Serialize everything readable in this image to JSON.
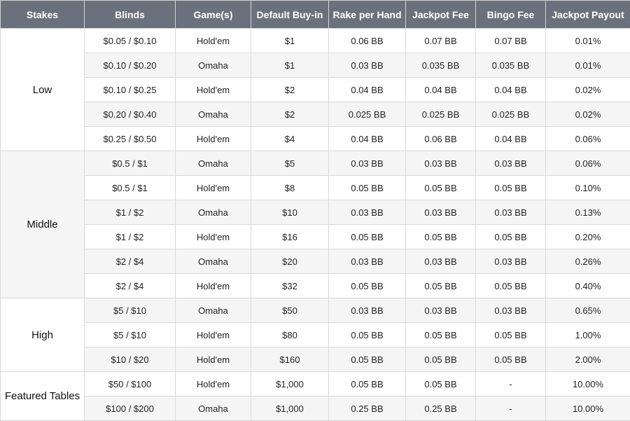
{
  "headers": [
    "Stakes",
    "Blinds",
    "Game(s)",
    "Default Buy-in",
    "Rake per Hand",
    "Jackpot Fee",
    "Bingo Fee",
    "Jackpot Payout"
  ],
  "groups": [
    {
      "stakes": "Low",
      "rows": [
        [
          "$0.05 / $0.10",
          "Hold'em",
          "$1",
          "0.06 BB",
          "0.07 BB",
          "0.07 BB",
          "0.01%"
        ],
        [
          "$0.10 / $0.20",
          "Omaha",
          "$1",
          "0.03 BB",
          "0.035 BB",
          "0.035 BB",
          "0.01%"
        ],
        [
          "$0.10 / $0.25",
          "Hold'em",
          "$2",
          "0.04 BB",
          "0.04 BB",
          "0.04 BB",
          "0.02%"
        ],
        [
          "$0.20 / $0.40",
          "Omaha",
          "$2",
          "0.025 BB",
          "0.025 BB",
          "0.025 BB",
          "0.02%"
        ],
        [
          "$0.25 / $0.50",
          "Hold'em",
          "$4",
          "0.04 BB",
          "0.06 BB",
          "0.04 BB",
          "0.06%"
        ]
      ]
    },
    {
      "stakes": "Middle",
      "rows": [
        [
          "$0.5 / $1",
          "Omaha",
          "$5",
          "0.03 BB",
          "0.03 BB",
          "0.03 BB",
          "0.06%"
        ],
        [
          "$0.5 / $1",
          "Hold'em",
          "$8",
          "0.05 BB",
          "0.05 BB",
          "0.05 BB",
          "0.10%"
        ],
        [
          "$1 / $2",
          "Omaha",
          "$10",
          "0.03 BB",
          "0.03 BB",
          "0.03 BB",
          "0.13%"
        ],
        [
          "$1 / $2",
          "Hold'em",
          "$16",
          "0.05 BB",
          "0.05 BB",
          "0.05 BB",
          "0.20%"
        ],
        [
          "$2 / $4",
          "Omaha",
          "$20",
          "0.03 BB",
          "0.03 BB",
          "0.03 BB",
          "0.26%"
        ],
        [
          "$2 / $4",
          "Hold'em",
          "$32",
          "0.05 BB",
          "0.05 BB",
          "0.05 BB",
          "0.40%"
        ]
      ]
    },
    {
      "stakes": "High",
      "rows": [
        [
          "$5 / $10",
          "Omaha",
          "$50",
          "0.03 BB",
          "0.03 BB",
          "0.03 BB",
          "0.65%"
        ],
        [
          "$5 / $10",
          "Hold'em",
          "$80",
          "0.05 BB",
          "0.05 BB",
          "0.05 BB",
          "1.00%"
        ],
        [
          "$10 / $20",
          "Hold'em",
          "$160",
          "0.05 BB",
          "0.05 BB",
          "0.05 BB",
          "2.00%"
        ]
      ]
    },
    {
      "stakes": "Featured Tables",
      "rows": [
        [
          "$50 / $100",
          "Hold'em",
          "$1,000",
          "0.05 BB",
          "0.05 BB",
          "-",
          "10.00%"
        ],
        [
          "$100 / $200",
          "Omaha",
          "$1,000",
          "0.25 BB",
          "0.25 BB",
          "-",
          "10.00%"
        ]
      ]
    }
  ],
  "colors": {
    "header_bg": "#6b717c",
    "header_text": "#ffffff",
    "row_alt_bg": "#f5f5f5",
    "border": "#d9d9d9"
  }
}
